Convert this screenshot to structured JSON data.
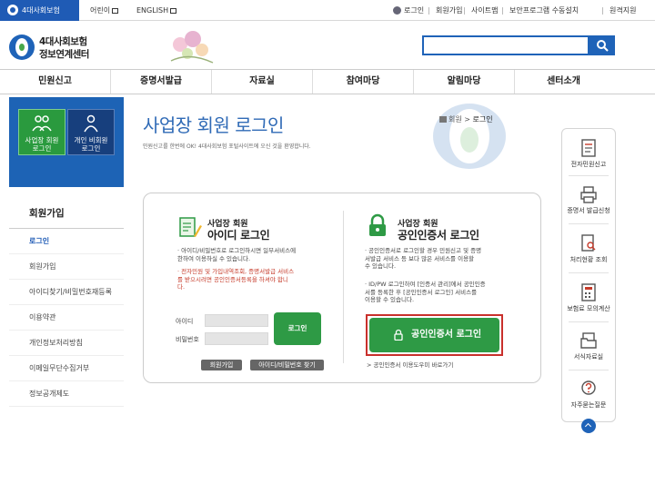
{
  "topbar": {
    "tabs": [
      "4대사회보험",
      "어린이",
      "ENGLISH"
    ],
    "links": [
      "로그인",
      "회원가입",
      "사이트맵",
      "보안프로그램 수동설치",
      "원격지원"
    ]
  },
  "header": {
    "brand_line1": "4대사회보험",
    "brand_line2": "정보연계센터",
    "search_placeholder": ""
  },
  "nav": [
    "민원신고",
    "증명서발급",
    "자료실",
    "참여마당",
    "알림마당",
    "센터소개"
  ],
  "left_panel": {
    "login_types": [
      {
        "label_l1": "사업장 회원",
        "label_l2": "로그인"
      },
      {
        "label_l1": "개인 비회원",
        "label_l2": "로그인"
      }
    ],
    "menu_title": "회원가입",
    "menu_items": [
      "로그인",
      "회원가입",
      "아이디찾기/비밀번호재등록",
      "이용약관",
      "개인정보처리방침",
      "이메일무단수집거부",
      "정보공개제도"
    ]
  },
  "content": {
    "title": "사업장 회원 로그인",
    "breadcrumb": [
      "회원",
      "로그인"
    ],
    "intro": "민원신고를 한번에 OK! 4대사회보험 포털사이트에 오신 것을 환영합니다.",
    "id_login": {
      "sub": "사업장 회원",
      "main": "아이디 로그인",
      "bullet1": "· 아이디/비밀번호로 로그인하시면 일부서비스에",
      "bullet1b": "  한하여 이용하실 수 있습니다.",
      "bullet2": "· 전자민원 및 가입내역조회, 증명서발급 서비스",
      "bullet2b": "  를 받으시려면 공인인증서등록을 하셔야 합니",
      "bullet2c": "  다.",
      "id_label": "아이디",
      "pw_label": "비밀번호",
      "login_button": "로그인",
      "join_button": "회원가입",
      "find_button": "아이디/비밀번호 찾기"
    },
    "cert_login": {
      "sub": "사업장 회원",
      "main": "공인인증서 로그인",
      "bullet1": "· 공인인증서로 로그인할 경우 민원신고 및 증명",
      "bullet1b": "  서발급 서비스 등 보다 많은 서비스를 이용할",
      "bullet1c": "  수 있습니다.",
      "bullet2": "· ID/PW 로그인하여 [인증서 관리]에서 공인인증",
      "bullet2b": "  서를 등록한 후 [공인인증서 로그인] 서비스를",
      "bullet2c": "  이용할 수 있습니다.",
      "button": "공인인증서 로그인",
      "help": "> 공인인증서 이용도우미 바로가기"
    }
  },
  "quick_menu": [
    "전자민원신고",
    "증명서 발급신청",
    "처리현황 조회",
    "보험료 모의계산",
    "서식자료실",
    "자주묻는질문"
  ],
  "colors": {
    "primary_blue": "#1f63b8",
    "green": "#2e9a45",
    "highlight_red": "#c9302c"
  }
}
